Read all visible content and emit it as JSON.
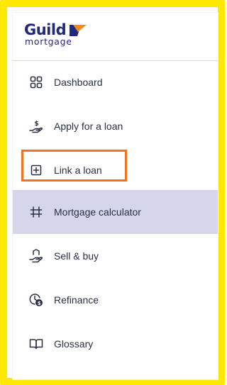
{
  "logo": {
    "word": "Guild",
    "subtitle": "mortgage",
    "colors": {
      "text": "#23297a",
      "mark_orange": "#f18a1e"
    }
  },
  "nav": {
    "items": [
      {
        "label": "Dashboard",
        "icon": "grid-icon"
      },
      {
        "label": "Apply for a loan",
        "icon": "hand-dollar-icon"
      },
      {
        "label": "Link a loan",
        "icon": "plus-square-icon",
        "highlighted": true
      },
      {
        "label": "Mortgage calculator",
        "icon": "calculator-sliders-icon",
        "active": true
      },
      {
        "label": "Sell & buy",
        "icon": "hand-house-icon"
      },
      {
        "label": "Refinance",
        "icon": "clock-dollar-icon"
      },
      {
        "label": "Glossary",
        "icon": "book-icon"
      }
    ]
  },
  "colors": {
    "frame": "#ffe800",
    "active_bg": "#d6d6ea",
    "highlight_border": "#f0711e",
    "text": "#2b2f44"
  }
}
